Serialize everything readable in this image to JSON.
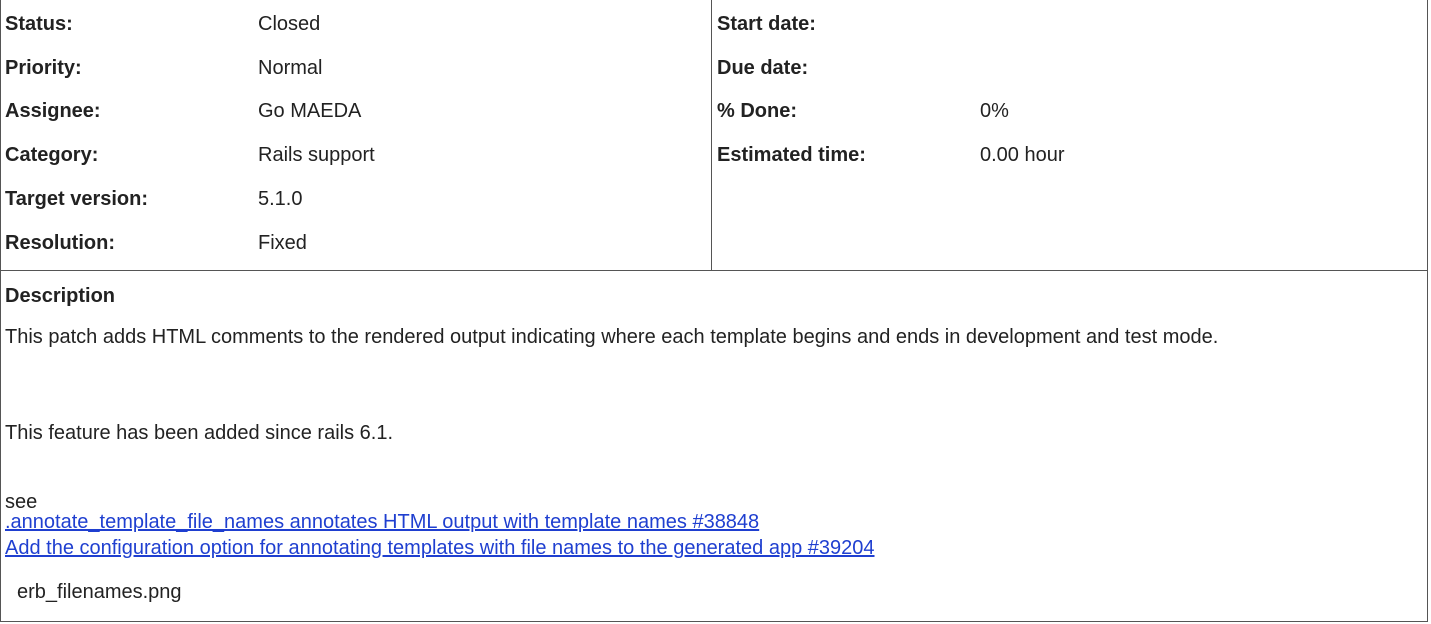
{
  "attributes": {
    "left": [
      {
        "label": "Status:",
        "value": "Closed"
      },
      {
        "label": "Priority:",
        "value": "Normal"
      },
      {
        "label": "Assignee:",
        "value": "Go MAEDA"
      },
      {
        "label": "Category:",
        "value": "Rails support"
      },
      {
        "label": "Target version:",
        "value": "5.1.0"
      },
      {
        "label": "Resolution:",
        "value": "Fixed"
      }
    ],
    "right": [
      {
        "label": "Start date:",
        "value": ""
      },
      {
        "label": "Due date:",
        "value": ""
      },
      {
        "label": "% Done:",
        "value": "0%"
      },
      {
        "label": "Estimated time:",
        "value": "0.00 hour"
      }
    ]
  },
  "description": {
    "title": "Description",
    "paragraph1": "This patch adds HTML comments to the rendered output indicating where each template begins and ends in development and test mode.",
    "paragraph2": "This feature has been added since rails 6.1.",
    "see_label": "see",
    "links": [
      ".annotate_template_file_names annotates HTML output with template names #38848",
      "Add the configuration option for annotating templates with file names to the generated app #39204"
    ],
    "attachment": "erb_filenames.png"
  }
}
